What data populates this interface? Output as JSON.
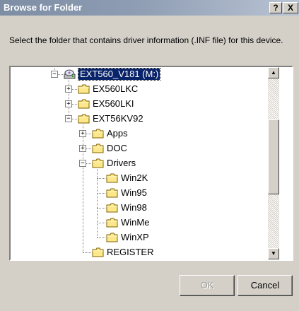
{
  "window": {
    "title": "Browse for Folder",
    "help_label": "?",
    "close_label": "X"
  },
  "description": "Select the folder that contains driver information (.INF file) for this device.",
  "tree": {
    "items": [
      {
        "label": "EXT560_V181 (M:)",
        "icon": "cd-drive-icon",
        "expander": "−",
        "selected": true
      },
      {
        "label": "EX560LKC",
        "icon": "folder-icon",
        "expander": "+"
      },
      {
        "label": "EX560LKI",
        "icon": "folder-icon",
        "expander": "+"
      },
      {
        "label": "EXT56KV92",
        "icon": "folder-icon",
        "expander": "−"
      },
      {
        "label": "Apps",
        "icon": "folder-icon",
        "expander": "+"
      },
      {
        "label": "DOC",
        "icon": "folder-icon",
        "expander": "+"
      },
      {
        "label": "Drivers",
        "icon": "folder-icon",
        "expander": "−"
      },
      {
        "label": "Win2K",
        "icon": "folder-icon"
      },
      {
        "label": "Win95",
        "icon": "folder-icon"
      },
      {
        "label": "Win98",
        "icon": "folder-icon"
      },
      {
        "label": "WinMe",
        "icon": "folder-icon"
      },
      {
        "label": "WinXP",
        "icon": "folder-icon"
      },
      {
        "label": "REGISTER",
        "icon": "folder-icon"
      }
    ]
  },
  "buttons": {
    "ok_label": "OK",
    "cancel_label": "Cancel"
  },
  "colors": {
    "title_bar": "#8e9db3",
    "selection": "#0a246a",
    "folder": "#fce88a"
  }
}
